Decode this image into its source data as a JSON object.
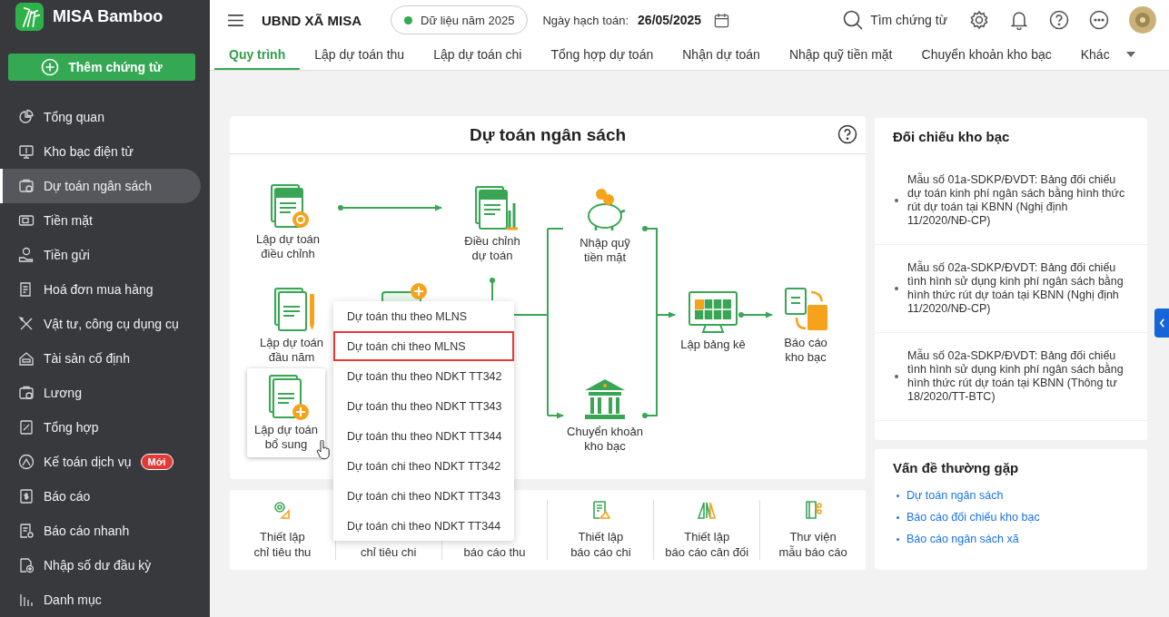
{
  "app": {
    "name": "MISA Bamboo"
  },
  "add_button": {
    "label": "Thêm chứng từ"
  },
  "sidebar": {
    "items": [
      {
        "label": "Tổng quan",
        "selected": false
      },
      {
        "label": "Kho bạc điện tử",
        "selected": false
      },
      {
        "label": "Dự toán ngân sách",
        "selected": true
      },
      {
        "label": "Tiền mặt",
        "selected": false
      },
      {
        "label": "Tiền gửi",
        "selected": false
      },
      {
        "label": "Hoá đơn mua hàng",
        "selected": false
      },
      {
        "label": "Vật tư, công cụ dụng cụ",
        "selected": false
      },
      {
        "label": "Tài sản cố định",
        "selected": false
      },
      {
        "label": "Lương",
        "selected": false
      },
      {
        "label": "Tổng hợp",
        "selected": false
      },
      {
        "label": "Kế toán dịch vụ",
        "selected": false,
        "badge": "Mới"
      },
      {
        "label": "Báo cáo",
        "selected": false
      },
      {
        "label": "Báo cáo nhanh",
        "selected": false
      },
      {
        "label": "Nhập số dư đầu kỳ",
        "selected": false
      },
      {
        "label": "Danh mục",
        "selected": false
      }
    ]
  },
  "topbar": {
    "unit": "UBND XÃ MISA",
    "data_year": "Dữ liệu năm 2025",
    "date_label": "Ngày hạch toán:",
    "date": "26/05/2025",
    "search_label": "Tìm chứng từ"
  },
  "tabs": [
    {
      "label": "Quy trình",
      "selected": true
    },
    {
      "label": "Lập dự toán thu",
      "selected": false
    },
    {
      "label": "Lập dự toán chi",
      "selected": false
    },
    {
      "label": "Tổng hợp dự toán",
      "selected": false
    },
    {
      "label": "Nhận dự toán",
      "selected": false
    },
    {
      "label": "Nhập quỹ tiền mặt",
      "selected": false
    },
    {
      "label": "Chuyển khoản kho bạc",
      "selected": false
    },
    {
      "label": "Khác",
      "selected": false
    }
  ],
  "budget_card": {
    "title": "Dự toán ngân sách",
    "nodes": [
      {
        "kind": "doc-gear",
        "label": "Lập dự toán\nđiều chỉnh",
        "highlighted": false
      },
      {
        "kind": "doc-chart",
        "label": "Điều chỉnh\ndự toán",
        "highlighted": false
      },
      {
        "kind": "piggy",
        "label": "Nhập quỹ\ntiền mặt",
        "highlighted": false
      },
      {
        "kind": "doc-pen",
        "label": "Lập dự toán\nđầu năm",
        "highlighted": false
      },
      {
        "kind": "doc-plus",
        "label": "Lập dự toán\nbổ sung",
        "highlighted": true
      },
      {
        "kind": "bank",
        "label": "Chuyển khoản\nkho bạc",
        "highlighted": false
      },
      {
        "kind": "screen",
        "label": "Lập bảng kê",
        "highlighted": false
      },
      {
        "kind": "transfer",
        "label": "Báo cáo\nkho bạc",
        "highlighted": false
      }
    ],
    "menu": {
      "items": [
        {
          "label": "Dự toán thu theo MLNS",
          "selected": false
        },
        {
          "label": "Dự toán chi theo MLNS",
          "selected": true
        },
        {
          "label": "Dự toán thu theo NDKT TT342",
          "selected": false
        },
        {
          "label": "Dự toán thu theo NDKT TT343",
          "selected": false
        },
        {
          "label": "Dự toán thu theo NDKT TT344",
          "selected": false
        },
        {
          "label": "Dự toán chi theo NDKT TT342",
          "selected": false
        },
        {
          "label": "Dự toán chi theo NDKT TT343",
          "selected": false
        },
        {
          "label": "Dự toán chi theo NDKT TT344",
          "selected": false
        }
      ]
    }
  },
  "tiles": [
    {
      "lines": [
        "Thiết lập",
        "chỉ tiêu thu"
      ]
    },
    {
      "lines": [
        "chỉ tiêu chi"
      ]
    },
    {
      "lines": [
        "báo cáo thu"
      ]
    },
    {
      "lines": [
        "Thiết lập",
        "báo cáo chi"
      ]
    },
    {
      "lines": [
        "Thiết lập",
        "báo cáo cân đối"
      ]
    },
    {
      "lines": [
        "Thư viện",
        "mẫu báo cáo"
      ]
    }
  ],
  "reconciliation": {
    "title": "Đối chiếu kho bạc",
    "items": [
      "Mẫu số 01a-SDKP/ĐVDT: Bảng đối chiếu dự toán kinh phí ngân sách bằng hình thức rút dự toán tại KBNN (Nghị định 11/2020/NĐ-CP)",
      "Mẫu số 02a-SDKP/ĐVDT: Bảng đối chiếu tình hình sử dụng kinh phí ngân sách bằng hình thức rút dự toán tại KBNN (Nghị định 11/2020/NĐ-CP)",
      "Mẫu số 02a-SDKP/ĐVDT: Bảng đối chiếu tình hình sử dụng kinh phí ngân sách bằng hình thức rút dự toán tại KBNN (Thông tư 18/2020/TT-BTC)"
    ]
  },
  "common_issues": {
    "title": "Vấn đề thường gặp",
    "links": [
      "Dự toán ngân sách",
      "Báo cáo đối chiếu kho bạc",
      "Báo cáo ngân sách xã"
    ]
  }
}
